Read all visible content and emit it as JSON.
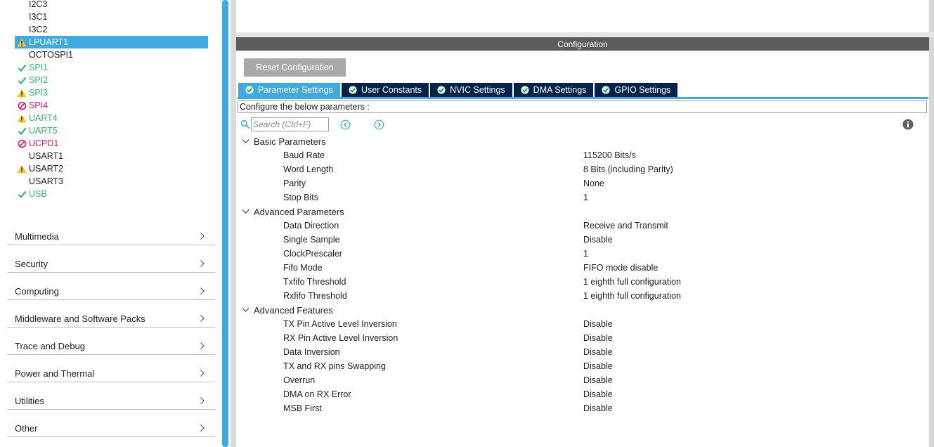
{
  "peripherals": [
    {
      "label": "I2C3",
      "status": "none"
    },
    {
      "label": "I3C1",
      "status": "none"
    },
    {
      "label": "I3C2",
      "status": "none"
    },
    {
      "label": "LPUART1",
      "status": "warn",
      "selected": true
    },
    {
      "label": "OCTOSPI1",
      "status": "none"
    },
    {
      "label": "SPI1",
      "status": "ok"
    },
    {
      "label": "SPI2",
      "status": "ok"
    },
    {
      "label": "SPI3",
      "status": "warn"
    },
    {
      "label": "SPI4",
      "status": "disabled"
    },
    {
      "label": "UART4",
      "status": "warn"
    },
    {
      "label": "UART5",
      "status": "ok"
    },
    {
      "label": "UCPD1",
      "status": "disabled"
    },
    {
      "label": "USART1",
      "status": "none"
    },
    {
      "label": "USART2",
      "status": "warn",
      "plain": true
    },
    {
      "label": "USART3",
      "status": "none"
    },
    {
      "label": "USB",
      "status": "ok"
    }
  ],
  "categories": [
    "Multimedia",
    "Security",
    "Computing",
    "Middleware and Software Packs",
    "Trace and Debug",
    "Power and Thermal",
    "Utilities",
    "Other"
  ],
  "config": {
    "header": "Configuration",
    "reset_label": "Reset Configuration",
    "hint": "Configure the below parameters :",
    "search_placeholder": "Search (Ctrl+F)"
  },
  "tabs": [
    {
      "label": "Parameter Settings",
      "active": true
    },
    {
      "label": "User Constants",
      "active": false
    },
    {
      "label": "NVIC Settings",
      "active": false
    },
    {
      "label": "DMA Settings",
      "active": false
    },
    {
      "label": "GPIO Settings",
      "active": false
    }
  ],
  "parameter_groups": [
    {
      "title": "Basic Parameters",
      "params": [
        {
          "name": "Baud Rate",
          "value": "115200 Bits/s"
        },
        {
          "name": "Word Length",
          "value": "8 Bits (including Parity)"
        },
        {
          "name": "Parity",
          "value": "None"
        },
        {
          "name": "Stop Bits",
          "value": "1"
        }
      ]
    },
    {
      "title": "Advanced Parameters",
      "params": [
        {
          "name": "Data Direction",
          "value": "Receive and Transmit"
        },
        {
          "name": "Single Sample",
          "value": "Disable"
        },
        {
          "name": "ClockPrescaler",
          "value": "1"
        },
        {
          "name": "Fifo Mode",
          "value": "FIFO mode disable"
        },
        {
          "name": "Txfifo Threshold",
          "value": "1 eighth full configuration"
        },
        {
          "name": "Rxfifo Threshold",
          "value": "1 eighth full configuration"
        }
      ]
    },
    {
      "title": "Advanced Features",
      "params": [
        {
          "name": "TX Pin Active Level Inversion",
          "value": "Disable"
        },
        {
          "name": "RX Pin Active Level Inversion",
          "value": "Disable"
        },
        {
          "name": "Data Inversion",
          "value": "Disable"
        },
        {
          "name": "TX and RX pins Swapping",
          "value": "Disable"
        },
        {
          "name": "Overrun",
          "value": "Disable"
        },
        {
          "name": "DMA on RX Error",
          "value": "Disable"
        },
        {
          "name": "MSB First",
          "value": "Disable"
        }
      ]
    }
  ],
  "colors": {
    "accent": "#3fa9e0",
    "tab_dark": "#03234b",
    "ok": "#3cb371",
    "warn": "#f5c518",
    "disabled": "#d6177c",
    "header_bg": "#5c5c5c"
  }
}
